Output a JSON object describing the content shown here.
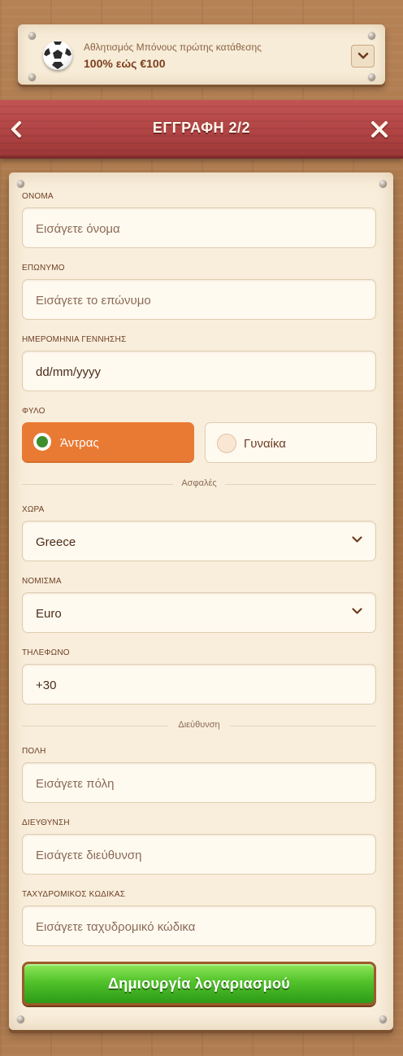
{
  "promo": {
    "subtitle": "Αθλητισμός Μπόνους πρώτης κατάθεσης",
    "title": "100% εώς €100"
  },
  "header": {
    "title": "ΕΓΓΡΑΦΗ 2/2"
  },
  "form": {
    "first_name": {
      "label": "ΟΝΟΜΑ",
      "placeholder": "Εισάγετε όνομα"
    },
    "last_name": {
      "label": "ΕΠΩΝΥΜΟ",
      "placeholder": "Εισάγετε το επώνυμο"
    },
    "birthdate": {
      "label": "ΗΜΕΡΟΜΗΝΙΑ ΓΕΝΝΗΣΗΣ",
      "placeholder": "dd/mm/yyyy"
    },
    "gender": {
      "label": "ΦΥΛΟ",
      "male": "Άντρας",
      "female": "Γυναίκα",
      "selected": "male"
    },
    "secure_divider": "Ασφαλές",
    "country": {
      "label": "ΧΩΡΑ",
      "value": "Greece"
    },
    "currency": {
      "label": "ΝΟΜΙΣΜΑ",
      "value": "Euro"
    },
    "phone": {
      "label": "ΤΗΛΕΦΩΝΟ",
      "value": "+30"
    },
    "address_divider": "Διεύθυνση",
    "city": {
      "label": "ΠΟΛΗ",
      "placeholder": "Εισάγετε πόλη"
    },
    "address": {
      "label": "ΔΙΕΥΘΥΝΣΗ",
      "placeholder": "Εισάγετε διεύθυνση"
    },
    "postal_code": {
      "label": "ΤΑΧΥΔΡΟΜΙΚΟΣ ΚΩΔΙΚΑΣ",
      "placeholder": "Εισάγετε ταχυδρομικό κώδικα"
    },
    "submit_label": "Δημιουργία λογαριασμού"
  },
  "colors": {
    "header_red": "#b24545",
    "selected_orange": "#e97a34",
    "cta_green": "#52c22b",
    "panel_cream": "#f8eedb"
  },
  "icons": {
    "promo": "soccer-ball-icon",
    "promo_toggle": "chevron-down-icon",
    "back": "chevron-left-icon",
    "close": "close-icon",
    "select": "chevron-down-icon"
  }
}
